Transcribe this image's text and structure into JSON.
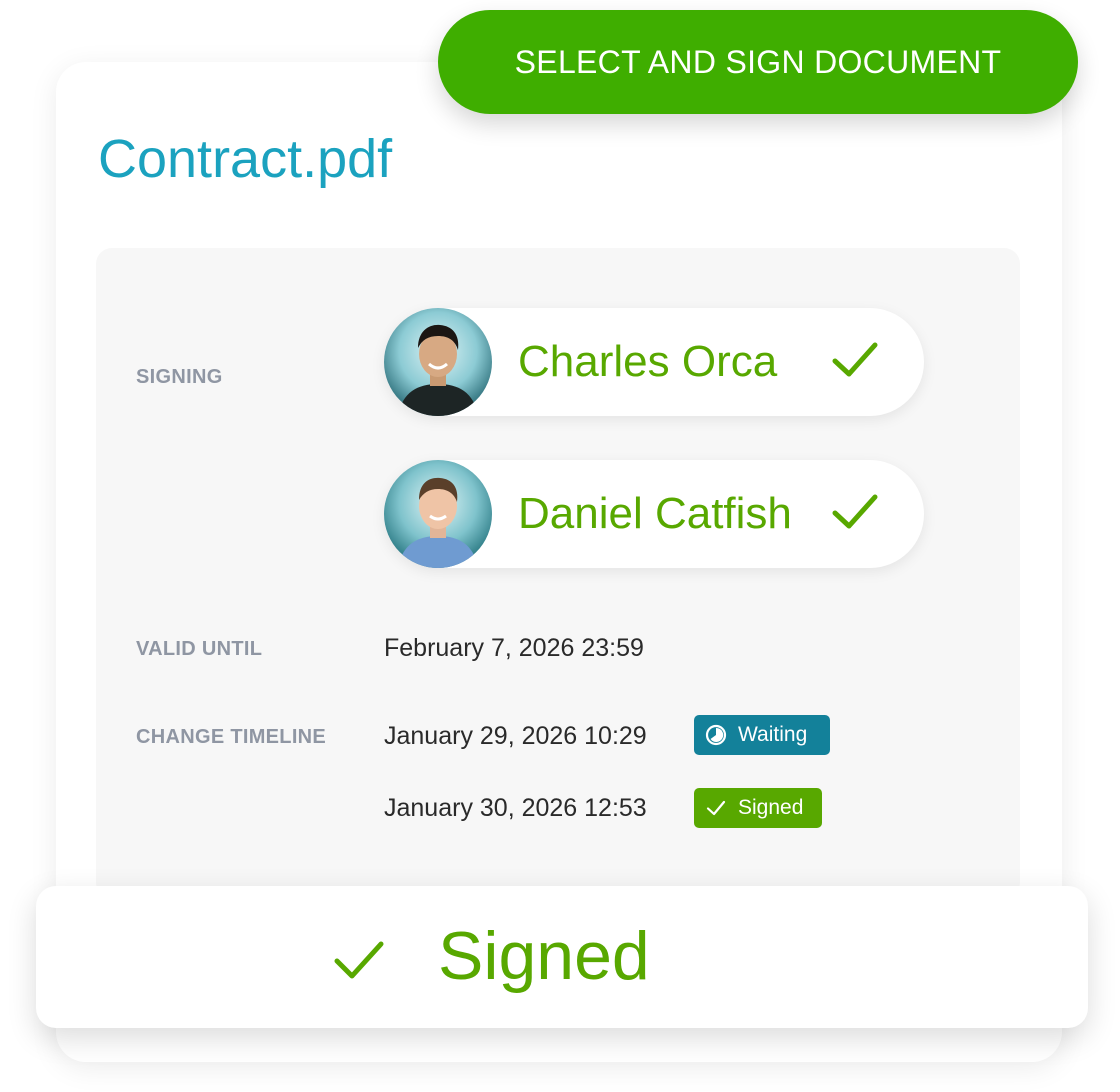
{
  "action": {
    "select_sign_label": "SELECT AND SIGN DOCUMENT"
  },
  "document": {
    "filename": "Contract.pdf"
  },
  "details": {
    "signing_label": "SIGNING",
    "signers": [
      {
        "name": "Charles Orca",
        "status_icon": "check-icon"
      },
      {
        "name": "Daniel Catfish",
        "status_icon": "check-icon"
      }
    ],
    "valid_until_label": "VALID UNTIL",
    "valid_until_value": "February 7, 2026 23:59",
    "timeline_label": "CHANGE TIMELINE",
    "timeline": [
      {
        "date": "January 29, 2026 10:29",
        "status": "Waiting",
        "icon": "clock-icon"
      },
      {
        "date": "January 30, 2026 12:53",
        "status": "Signed",
        "icon": "check-icon"
      }
    ]
  },
  "status": {
    "text": "Signed",
    "icon": "check-icon"
  },
  "colors": {
    "brand_green": "#3fae00",
    "text_green": "#58a800",
    "title_blue": "#1ba2bf",
    "waiting_teal": "#13819a",
    "label_gray": "#8f96a3"
  }
}
